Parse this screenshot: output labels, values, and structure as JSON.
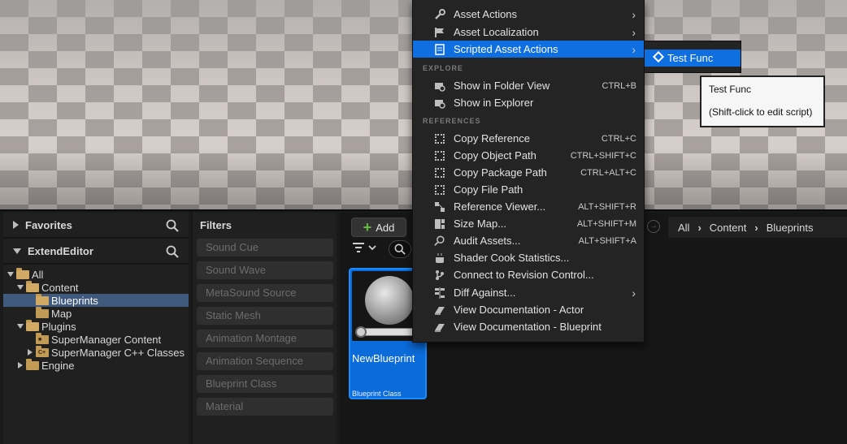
{
  "content_browser": {
    "favorites_label": "Favorites",
    "project_label": "ExtendEditor",
    "tree": [
      {
        "label": "All"
      },
      {
        "label": "Content"
      },
      {
        "label": "Blueprints"
      },
      {
        "label": "Map"
      },
      {
        "label": "Plugins"
      },
      {
        "label": "SuperManager Content"
      },
      {
        "label": "SuperManager C++ Classes"
      },
      {
        "label": "Engine"
      }
    ],
    "filters_title": "Filters",
    "filters": [
      "Sound Cue",
      "Sound Wave",
      "MetaSound Source",
      "Static Mesh",
      "Animation Montage",
      "Animation Sequence",
      "Blueprint Class",
      "Material"
    ],
    "add_label": "Add",
    "breadcrumb": [
      "All",
      "Content",
      "Blueprints"
    ],
    "asset": {
      "name": "NewBlueprint",
      "type": "Blueprint Class"
    }
  },
  "context_menu": {
    "items_top": [
      {
        "label": "Asset Actions",
        "icon": "wrench-icon"
      },
      {
        "label": "Asset Localization",
        "icon": "flag-icon"
      },
      {
        "label": "Scripted Asset Actions",
        "icon": "script-icon"
      }
    ],
    "explore_header": "EXPLORE",
    "explore": [
      {
        "label": "Show in Folder View",
        "shortcut": "CTRL+B"
      },
      {
        "label": "Show in Explorer",
        "shortcut": ""
      }
    ],
    "references_header": "REFERENCES",
    "references": [
      {
        "label": "Copy Reference",
        "shortcut": "CTRL+C"
      },
      {
        "label": "Copy Object Path",
        "shortcut": "CTRL+SHIFT+C"
      },
      {
        "label": "Copy Package Path",
        "shortcut": "CTRL+ALT+C"
      },
      {
        "label": "Copy File Path",
        "shortcut": ""
      },
      {
        "label": "Reference Viewer...",
        "shortcut": "ALT+SHIFT+R"
      },
      {
        "label": "Size Map...",
        "shortcut": "ALT+SHIFT+M"
      },
      {
        "label": "Audit Assets...",
        "shortcut": "ALT+SHIFT+A"
      },
      {
        "label": "Shader Cook Statistics...",
        "shortcut": ""
      },
      {
        "label": "Connect to Revision Control...",
        "shortcut": ""
      },
      {
        "label": "Diff Against...",
        "shortcut": ""
      },
      {
        "label": "View Documentation - Actor",
        "shortcut": ""
      },
      {
        "label": "View Documentation - Blueprint",
        "shortcut": ""
      }
    ]
  },
  "submenu": {
    "item": "Test Func"
  },
  "tooltip": {
    "line1": "Test Func",
    "line2": "(Shift-click to edit script)"
  },
  "colors": {
    "highlight": "#0f6fe0",
    "selection": "#3f5a7d",
    "folder": "#c19a55"
  }
}
